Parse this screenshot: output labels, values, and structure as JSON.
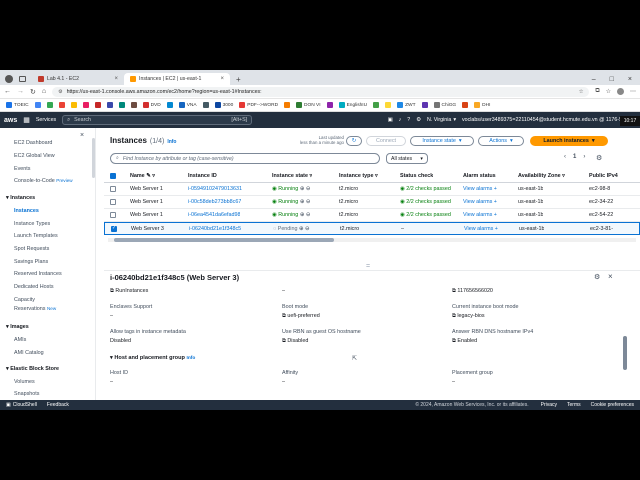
{
  "browser": {
    "tabs": [
      {
        "title": "Lab 4.1 - EC2",
        "active": false
      },
      {
        "title": "Instances | EC2 | us-east-1",
        "active": true
      }
    ],
    "new_tab": "+",
    "url": "https://us-east-1.console.aws.amazon.com/ec2/home?region=us-east-1#Instances:",
    "bookmarks": [
      "TOEIC",
      "",
      "",
      "",
      "",
      "",
      "",
      "",
      "",
      "",
      "DVD",
      "",
      "VNA",
      "",
      "3000",
      "PDF-->WORD",
      "",
      "DON VI",
      "",
      "EnglishIU",
      "",
      "",
      "ZWT",
      "",
      "ChiGG",
      "",
      "DHI"
    ]
  },
  "aws": {
    "logo": "aws",
    "services_label": "Services",
    "search_placeholder": "Search",
    "search_shortcut": "[Alt+S]",
    "region": "N. Virginia",
    "account": "voclabs/user3489375=22110454@student.hcmute.edu.vn @ 1176-5",
    "time": "10:17"
  },
  "sidebar": {
    "items": [
      {
        "label": "EC2 Dashboard",
        "type": "item"
      },
      {
        "label": "EC2 Global View",
        "type": "item"
      },
      {
        "label": "Events",
        "type": "item"
      },
      {
        "label": "Console-to-Code",
        "badge": "Preview",
        "type": "item"
      },
      {
        "label": "Instances",
        "type": "header"
      },
      {
        "label": "Instances",
        "type": "item",
        "active": true
      },
      {
        "label": "Instance Types",
        "type": "item"
      },
      {
        "label": "Launch Templates",
        "type": "item"
      },
      {
        "label": "Spot Requests",
        "type": "item"
      },
      {
        "label": "Savings Plans",
        "type": "item"
      },
      {
        "label": "Reserved Instances",
        "type": "item"
      },
      {
        "label": "Dedicated Hosts",
        "type": "item"
      },
      {
        "label": "Capacity",
        "type": "item"
      },
      {
        "label": "Reservations",
        "badge": "New",
        "type": "item"
      },
      {
        "label": "Images",
        "type": "header"
      },
      {
        "label": "AMIs",
        "type": "item"
      },
      {
        "label": "AMI Catalog",
        "type": "item"
      },
      {
        "label": "Elastic Block Store",
        "type": "header"
      },
      {
        "label": "Volumes",
        "type": "item"
      },
      {
        "label": "Snapshots",
        "type": "item"
      }
    ]
  },
  "instances": {
    "title": "Instances",
    "count": "(1/4)",
    "info": "Info",
    "last_updated": "Last updated",
    "last_updated_time": "less than a minute ago",
    "connect": "Connect",
    "instance_state": "Instance state",
    "actions": "Actions",
    "launch": "Launch instances",
    "filter_placeholder": "Find Instance by attribute or tag (case-sensitive)",
    "state_filter": "All states",
    "page": "1",
    "columns": [
      "Name",
      "Instance ID",
      "Instance state",
      "Instance type",
      "Status check",
      "Alarm status",
      "Availability Zone",
      "Public IPv4"
    ],
    "rows": [
      {
        "name": "Web Server 1",
        "id": "i-05949102479013631",
        "state": "Running",
        "type": "t2.micro",
        "check": "2/2 checks passed",
        "alarm": "View alarms",
        "az": "us-east-1b",
        "ip": "ec2-98-8",
        "selected": false
      },
      {
        "name": "Web Server 1",
        "id": "i-00c58deb273bb8c67",
        "state": "Running",
        "type": "t2.micro",
        "check": "2/2 checks passed",
        "alarm": "View alarms",
        "az": "us-east-1b",
        "ip": "ec2-34-22",
        "selected": false
      },
      {
        "name": "Web Server 1",
        "id": "i-06ea4541da6efad98",
        "state": "Running",
        "type": "t2.micro",
        "check": "2/2 checks passed",
        "alarm": "View alarms",
        "az": "us-east-1b",
        "ip": "ec2-54-22",
        "selected": false
      },
      {
        "name": "Web Server 3",
        "id": "i-06240bd21e1f348c5",
        "state": "Pending",
        "type": "t2.micro",
        "check": "–",
        "alarm": "View alarms",
        "az": "us-east-1b",
        "ip": "ec2-3-81-",
        "selected": true
      }
    ]
  },
  "details": {
    "title": "i-06240bd21e1f348c5 (Web Server 3)",
    "fields": [
      {
        "label": "",
        "value": "RunInstances"
      },
      {
        "label": "",
        "value": "–"
      },
      {
        "label": "",
        "value": "117656566020"
      },
      {
        "label": "Enclaves Support",
        "value": "–"
      },
      {
        "label": "Boot mode",
        "value": "uefi-preferred"
      },
      {
        "label": "Current instance boot mode",
        "value": "legacy-bios"
      },
      {
        "label": "Allow tags in instance metadata",
        "value": "Disabled"
      },
      {
        "label": "Use RBN as guest OS hostname",
        "value": "Disabled"
      },
      {
        "label": "Answer RBN DNS hostname IPv4",
        "value": "Enabled"
      },
      {
        "label": "Host ID",
        "value": "–"
      },
      {
        "label": "Affinity",
        "value": "–"
      },
      {
        "label": "Placement group",
        "value": "–"
      }
    ],
    "section": "Host and placement group",
    "section_info": "Info"
  },
  "footer": {
    "cloudshell": "CloudShell",
    "feedback": "Feedback",
    "copyright": "© 2024, Amazon Web Services, Inc. or its affiliates.",
    "privacy": "Privacy",
    "terms": "Terms",
    "cookies": "Cookie preferences"
  },
  "colors": {
    "aws_nav": "#232f3e",
    "link": "#0972d3",
    "primary": "#ff9900",
    "running": "#037f0c"
  }
}
